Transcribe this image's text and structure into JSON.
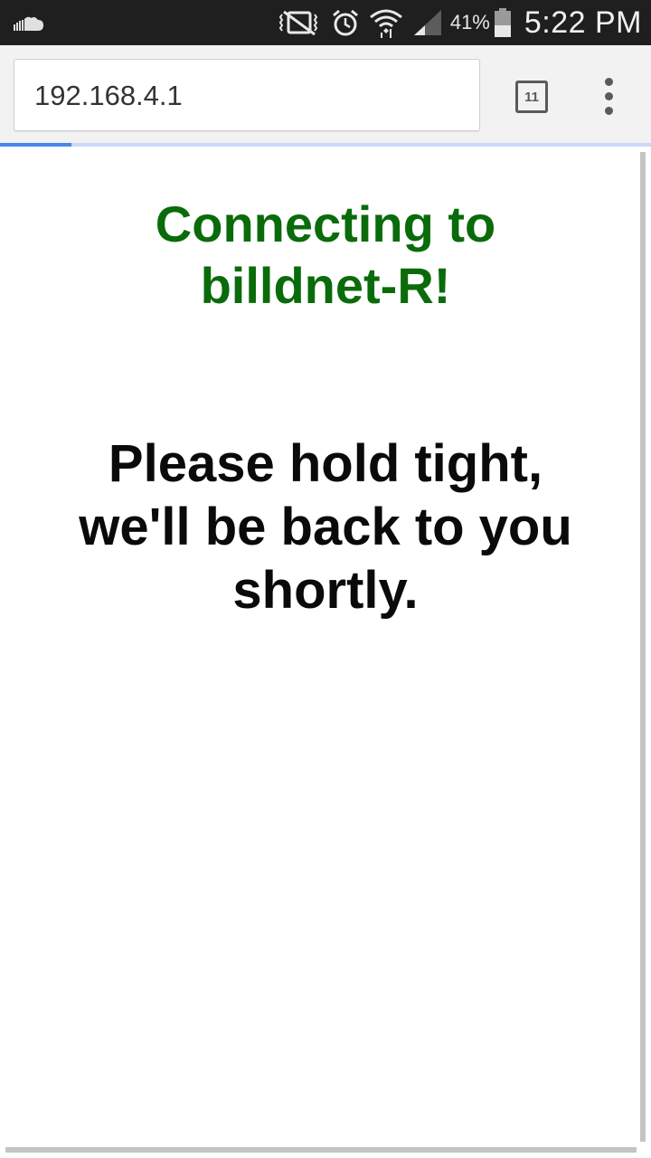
{
  "status_bar": {
    "notification_icon": "soundcloud-icon",
    "icons": [
      "vibrate-mute-icon",
      "alarm-icon",
      "wifi-icon",
      "signal-icon"
    ],
    "battery_percent": "41%",
    "battery_level": 0.41,
    "time": "5:22 PM"
  },
  "browser": {
    "url": "192.168.4.1",
    "tab_count": "11",
    "menu_icon": "more-vert-icon",
    "load_progress": 0.11
  },
  "page": {
    "heading_line1": "Connecting to",
    "heading_line2": "billdnet-R!",
    "message_line1": "Please hold tight,",
    "message_line2": "we'll be back to you",
    "message_line3": "shortly."
  },
  "colors": {
    "heading": "#0a6b0a",
    "progress": "#4a86e8",
    "status_bar": "#1f1f1f"
  }
}
